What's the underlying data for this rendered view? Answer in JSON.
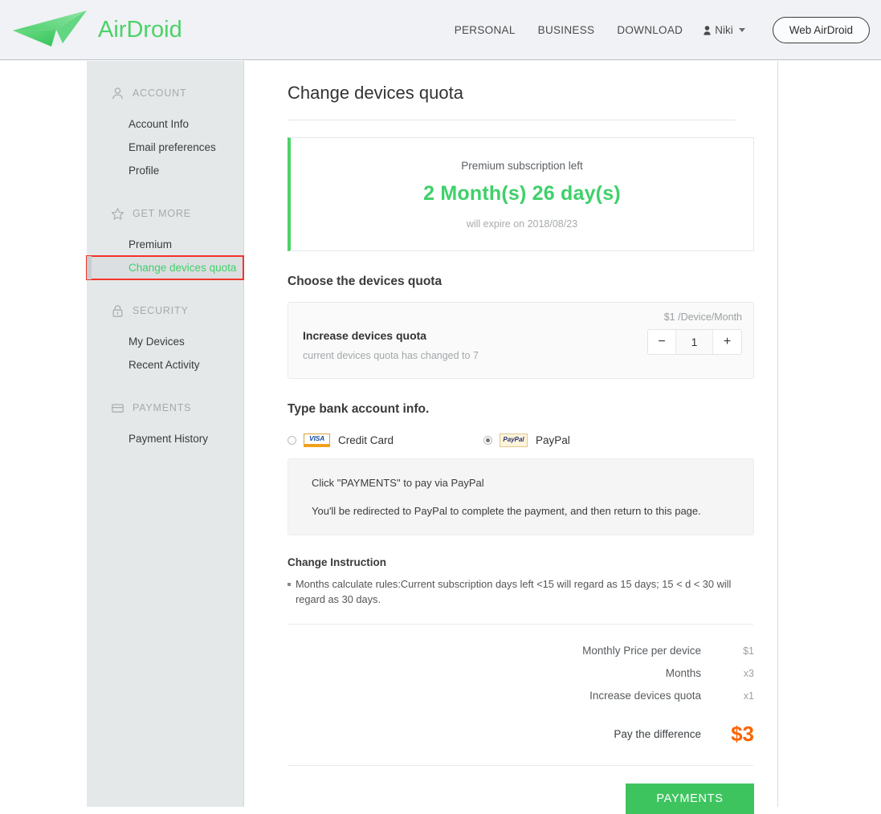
{
  "header": {
    "logo_text": "AirDroid",
    "nav": [
      {
        "label": "PERSONAL"
      },
      {
        "label": "BUSINESS"
      },
      {
        "label": "DOWNLOAD"
      }
    ],
    "user": {
      "name": "Niki",
      "icon": "person-icon",
      "caret": "chevron-down-icon"
    },
    "web_button": "Web AirDroid",
    "bg_color": "#f0f2f5",
    "brand_green": "#4cd268"
  },
  "sidebar": {
    "groups": [
      {
        "icon": "person-icon",
        "label": "ACCOUNT",
        "items": [
          {
            "label": "Account Info",
            "active": false
          },
          {
            "label": "Email preferences",
            "active": false
          },
          {
            "label": "Profile",
            "active": false
          }
        ]
      },
      {
        "icon": "star-icon",
        "label": "GET MORE",
        "items": [
          {
            "label": "Premium",
            "active": false
          },
          {
            "label": "Change devices quota",
            "active": true
          }
        ]
      },
      {
        "icon": "lock-icon",
        "label": "SECURITY",
        "items": [
          {
            "label": "My Devices",
            "active": false
          },
          {
            "label": "Recent Activity",
            "active": false
          }
        ]
      },
      {
        "icon": "credit-card-icon",
        "label": "PAYMENTS",
        "items": [
          {
            "label": "Payment History",
            "active": false
          }
        ]
      }
    ],
    "active_color": "#3fd06a",
    "highlight_border_color": "#f4342c"
  },
  "main": {
    "page_title": "Change devices quota",
    "premium": {
      "caption": "Premium subscription left",
      "remaining": "2 Month(s) 26 day(s)",
      "expiry": "will expire on 2018/08/23",
      "accent_color": "#4cd268"
    },
    "quota_section": {
      "heading": "Choose the devices quota",
      "price_note": "$1 /Device/Month",
      "label": "Increase devices quota",
      "note": "current devices quota has changed to 7",
      "stepper": {
        "minus": "−",
        "value": "1",
        "plus": "+"
      }
    },
    "bank_section": {
      "heading": "Type bank account info.",
      "options": [
        {
          "id": "credit-card",
          "badge": "VISA",
          "label": "Credit Card",
          "selected": false
        },
        {
          "id": "paypal",
          "badge": "PayPal",
          "label": "PayPal",
          "selected": true
        }
      ],
      "info_line_1": "Click \"PAYMENTS\" to pay via PayPal",
      "info_line_2": "You'll be redirected to PayPal to complete the payment, and then return to this page."
    },
    "instruction": {
      "heading": "Change Instruction",
      "text": "Months calculate rules:Current subscription days left <15 will regard as 15 days; 15 < d < 30 will regard as 30 days."
    },
    "summary": {
      "rows": [
        {
          "label": "Monthly Price per device",
          "value": "$1"
        },
        {
          "label": "Months",
          "value": "x3"
        },
        {
          "label": "Increase devices quota",
          "value": "x1"
        }
      ],
      "total_label": "Pay the difference",
      "total_value": "$3",
      "total_color": "#fa6400"
    },
    "submit_button": "PAYMENTS",
    "submit_button_color": "#3ec45f"
  }
}
